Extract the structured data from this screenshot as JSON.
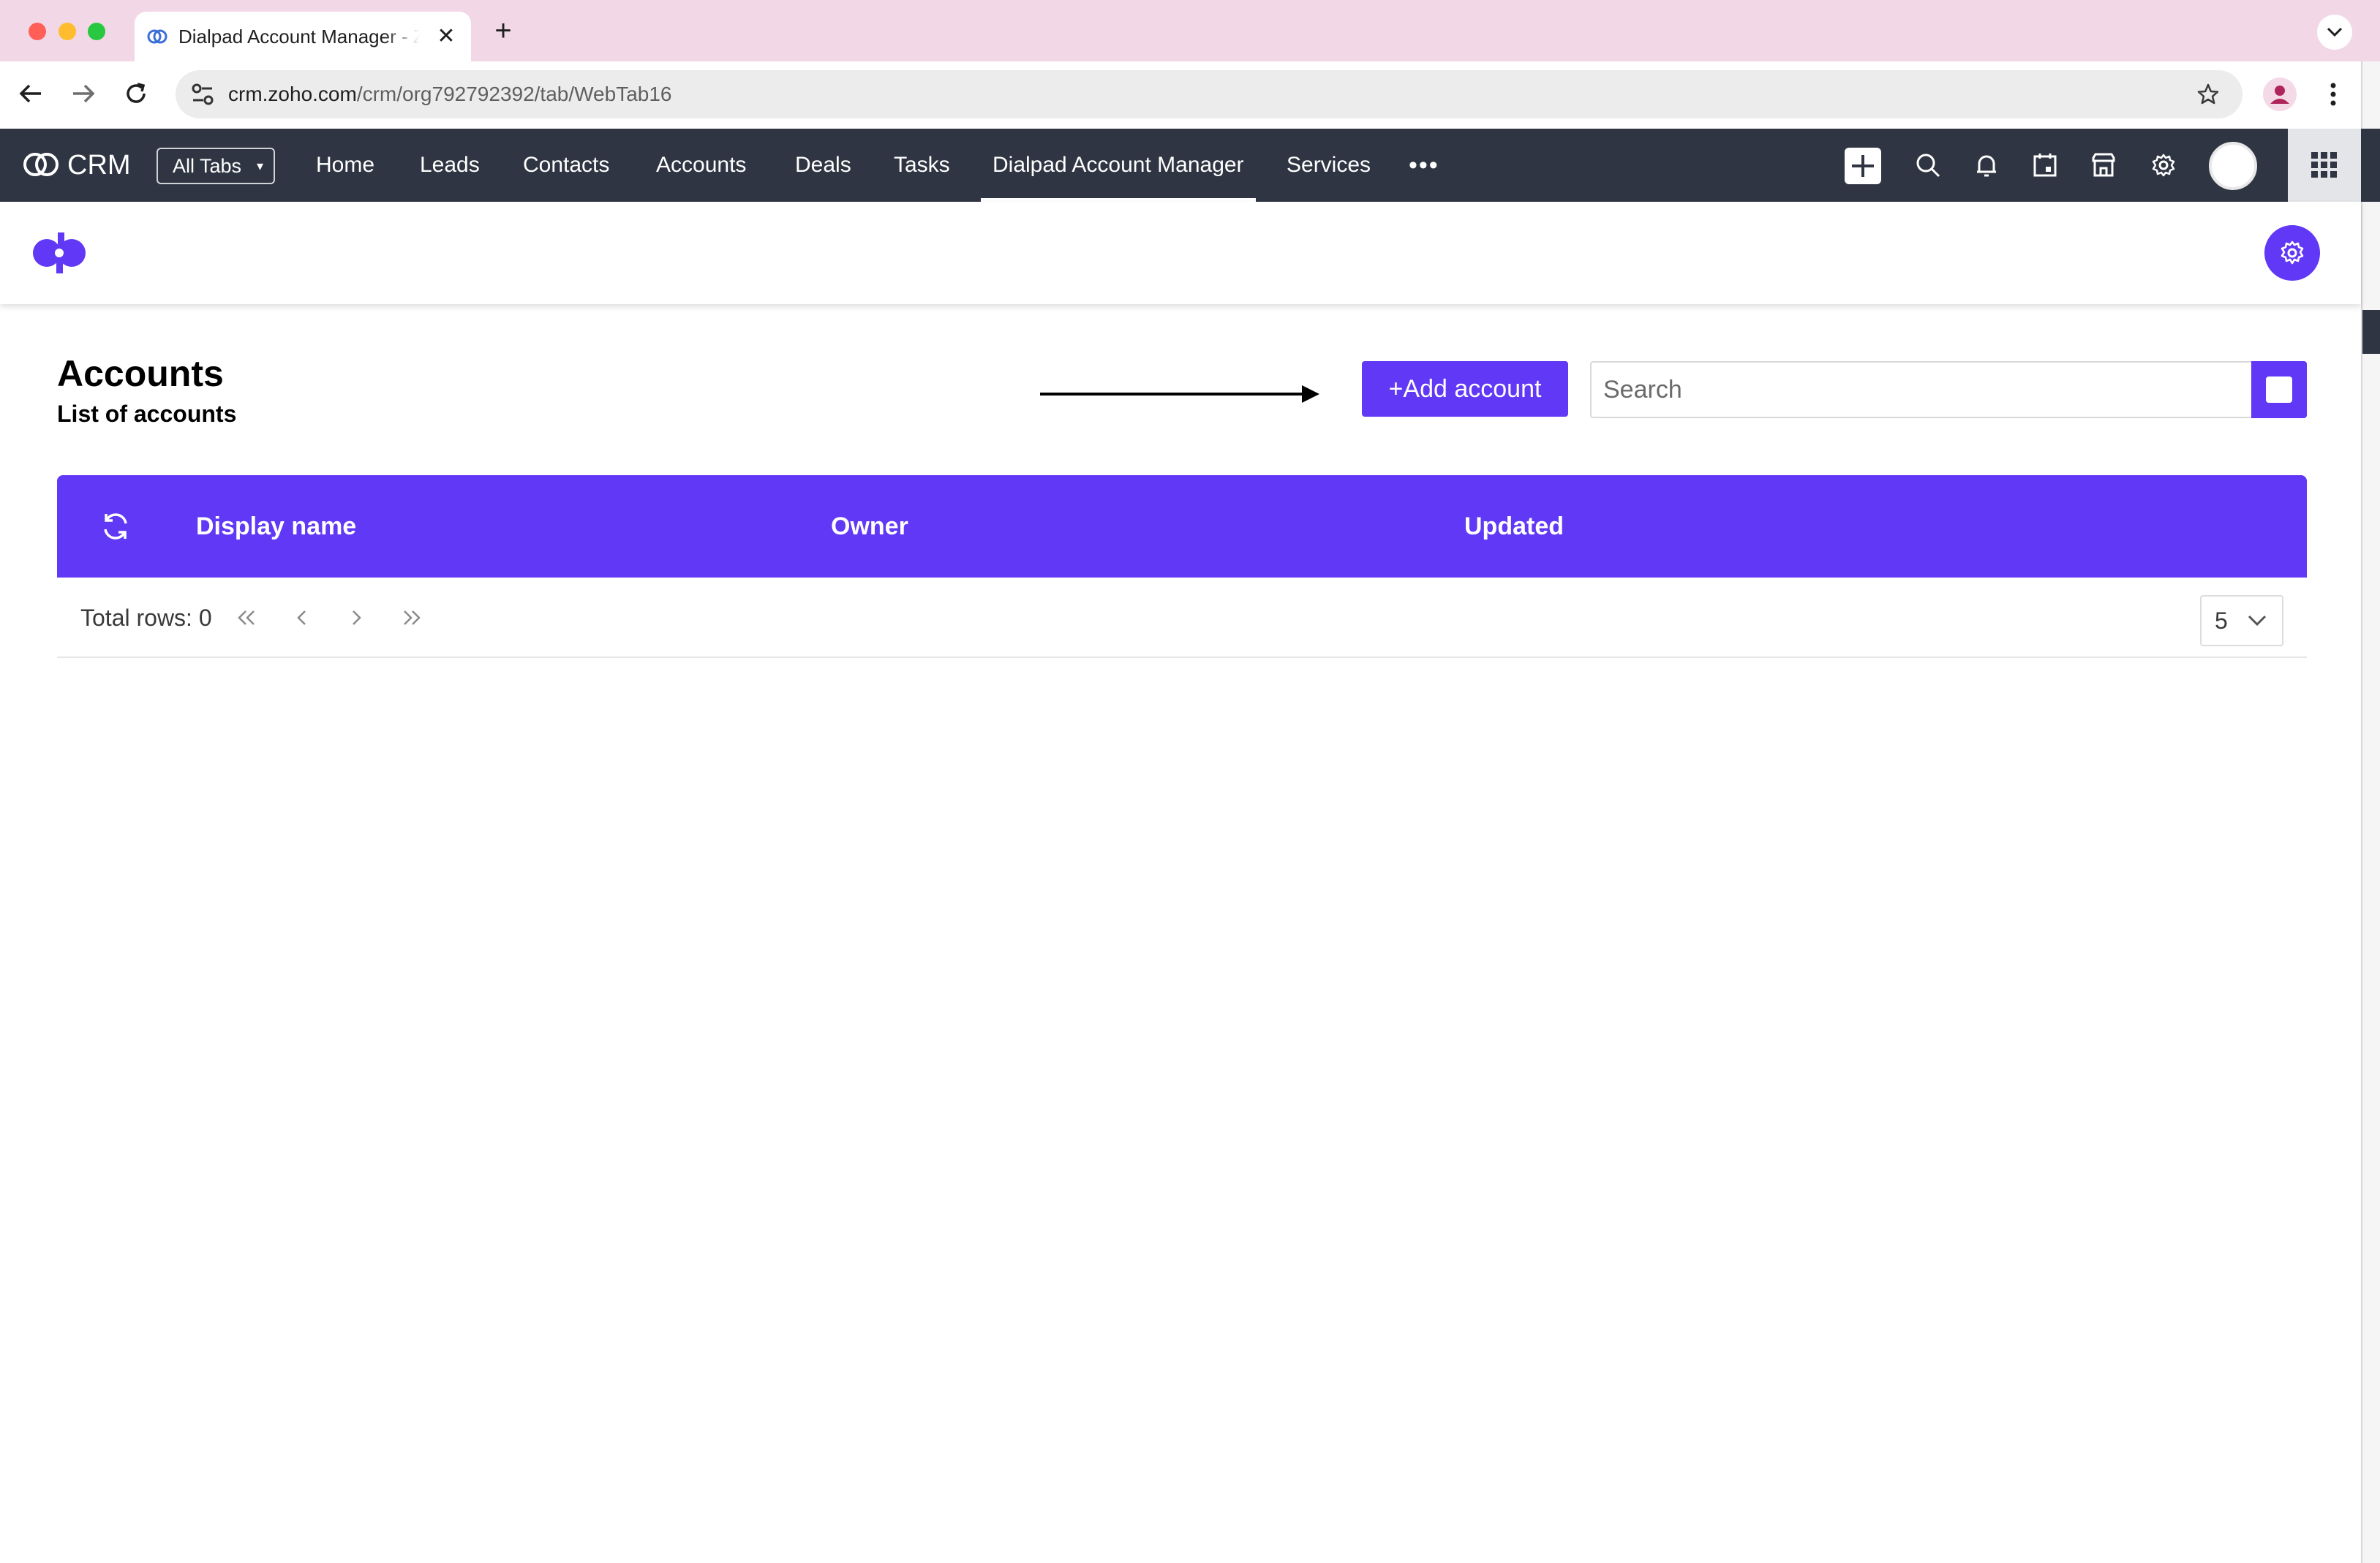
{
  "browser": {
    "tab_title": "Dialpad Account Manager - Zoho CRM",
    "url_host": "crm.zoho.com",
    "url_path": "/crm/org792792392/tab/WebTab16",
    "new_tab_label": "+",
    "tab_close_label": "✕"
  },
  "crm": {
    "app_name": "CRM",
    "all_tabs_label": "All Tabs",
    "nav": [
      "Home",
      "Leads",
      "Contacts",
      "Accounts",
      "Deals",
      "Tasks",
      "Dialpad Account Manager",
      "Services"
    ],
    "active_nav": "Dialpad Account Manager",
    "more_label": "•••"
  },
  "page": {
    "title": "Accounts",
    "subtitle": "List of accounts",
    "add_button_label": "+Add account",
    "search_placeholder": "Search"
  },
  "table": {
    "columns": [
      "Display name",
      "Owner",
      "Updated"
    ],
    "rows": [],
    "total_rows_label": "Total rows: 0",
    "page_size": "5",
    "pagination": {
      "first": "«",
      "prev": "‹",
      "next": "›",
      "last": "»"
    }
  },
  "theme": {
    "accent": "#6138f5",
    "crm_bar": "#2f3542",
    "tabstrip": "#f2d8e6"
  },
  "icons": [
    "dialpad-logo-icon",
    "settings-icon",
    "refresh-icon",
    "search-icon",
    "bell-icon",
    "calendar-icon",
    "marketplace-icon",
    "gear-icon",
    "apps-grid-icon",
    "star-icon",
    "arrow-icon"
  ]
}
